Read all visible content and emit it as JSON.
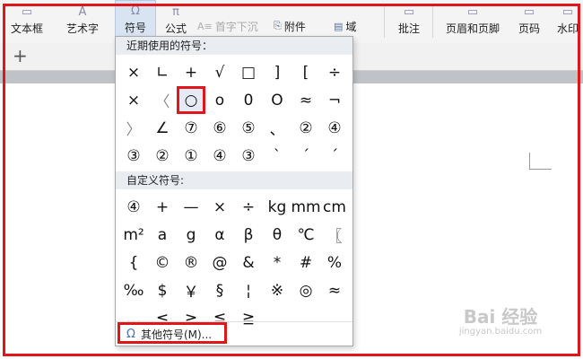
{
  "ribbon": {
    "textbox": "文本框",
    "wordart": "艺术字",
    "symbol": "符号",
    "formula": "公式",
    "dropcap": "首字下沉",
    "attachment": "附件",
    "field": "域",
    "comment": "批注",
    "header_footer": "页眉和页脚",
    "page_number": "页码",
    "watermark": "水印"
  },
  "dropdown": {
    "recent_title": "近期使用的符号：",
    "recent": [
      "×",
      "∟",
      "+",
      "√",
      "□",
      "]",
      "[",
      "÷",
      "×",
      "〈",
      "○",
      "o",
      "0",
      "O",
      "≈",
      "¬",
      "〉",
      "∠",
      "⑦",
      "⑥",
      "⑤",
      "、",
      "②",
      "④",
      "③",
      "②",
      "①",
      "④",
      "③",
      "ˋ",
      "ˊ",
      "ˊ"
    ],
    "custom_title": "自定义符号:",
    "custom": [
      "④",
      "+",
      "—",
      "×",
      "÷",
      "kg",
      "mm",
      "cm",
      "m²",
      "a",
      "g",
      "α",
      "β",
      "θ",
      "℃",
      "〖",
      "{",
      "©",
      "®",
      "@",
      "&",
      "*",
      "#",
      "%",
      "‰",
      "$",
      "￥",
      "§",
      "¦",
      "※",
      "◎",
      "≈",
      "…",
      "≤",
      "≥",
      "≦",
      "≧"
    ],
    "more_label": "其他符号(M)..."
  },
  "watermark": {
    "top": "Bai 经验",
    "bottom": "jingyan.baidu.com"
  },
  "colors": {
    "annotation_red": "#e0161b",
    "section_bg": "#e9ecf1"
  }
}
